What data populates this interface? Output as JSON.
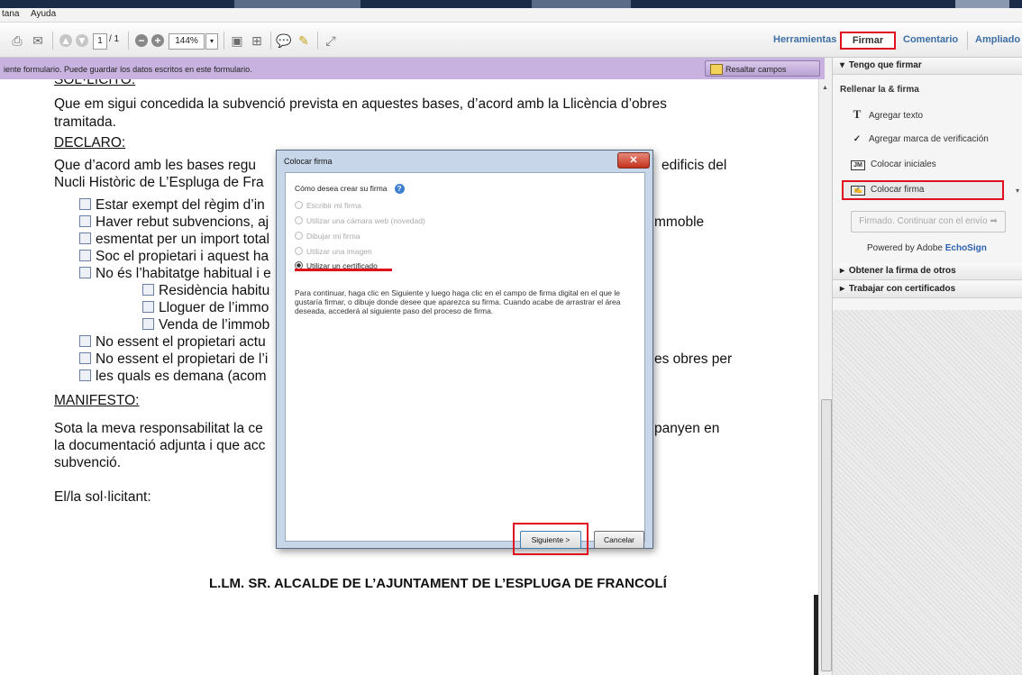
{
  "menubar": {
    "items": [
      "tana",
      "Ayuda"
    ]
  },
  "toolbar": {
    "page_current": "1",
    "page_total": "/ 1",
    "zoom": "144%",
    "tabs": {
      "herramientas": "Herramientas",
      "firmar": "Firmar",
      "comentario": "Comentario",
      "ampliado": "Ampliado"
    }
  },
  "formbar": {
    "message": "iente formulario. Puede guardar los datos escritos en este formulario.",
    "highlight_button": "Resaltar campos existentes"
  },
  "document": {
    "top_cut": "SOL·LICITO:",
    "p1_l1": "Que em sigui concedida la subvenció prevista en aquestes bases, d’acord amb la Llicència d’obres",
    "p1_l2": "tramitada.",
    "declaro": "DECLARO:",
    "p2_l1a": "Que d’acord amb les bases regu",
    "p2_l1b": "edificis del",
    "p2_l2": "Nucli Històric de L’Espluga de Fra",
    "cb1": "Estar exempt del règim d’in",
    "cb2a": "Haver rebut subvencions, aj",
    "cb2b": "mmoble",
    "cb3": "esmentat per un import total",
    "cb4": "Soc el propietari i aquest ha",
    "cb5": "No és l’habitatge habitual i e",
    "cb6": "Residència habitu",
    "cb7": "Lloguer de l’immo",
    "cb8": "Venda de l’immob",
    "cb9": "No essent el propietari actu",
    "cb10a": "No essent el propietari de l’i",
    "cb10b": "es obres per",
    "cb11": "les quals es demana (acom",
    "manifesto": "MANIFESTO:",
    "p3_l1a": "Sota la meva responsabilitat la ce",
    "p3_l1b": "panyen en",
    "p3_l2": "la documentació adjunta i que acc",
    "p3_l3": "subvenció.",
    "sol": "El/la sol·licitant:",
    "footer": "L.LM. SR. ALCALDE DE L’AJUNTAMENT DE L’ESPLUGA DE FRANCOLÍ"
  },
  "right_panel": {
    "section1": "Tengo que firmar",
    "subheading": "Rellenar la & firma",
    "items": [
      {
        "icon": "text-icon",
        "label": "Agregar texto"
      },
      {
        "icon": "checkmark-icon",
        "label": "Agregar marca de verificación"
      },
      {
        "icon": "initials-icon",
        "label": "Colocar iniciales"
      },
      {
        "icon": "signature-icon",
        "label": "Colocar firma"
      }
    ],
    "firmado_button": "Firmado. Continuar con el envío",
    "powered_by": "Powered by Adobe",
    "echosign": "EchoSign",
    "section2": "Obtener la firma de otros",
    "section3": "Trabajar con certificados"
  },
  "dialog": {
    "title": "Colocar firma",
    "question": "Cómo desea crear su firma",
    "options": [
      {
        "label": "Escribir mi firma",
        "selected": false
      },
      {
        "label": "Utilizar una cámara web (novedad)",
        "selected": false
      },
      {
        "label": "Dibujar mi firma",
        "selected": false
      },
      {
        "label": "Utilizar una imagen",
        "selected": false
      },
      {
        "label": "Utilizar un certificado",
        "selected": true
      }
    ],
    "paragraph": "Para continuar, haga clic en Siguiente y luego haga clic en el campo de firma digital en el que le gustaría firmar, o dibuje donde desee que aparezca su firma. Cuando acabe de arrastrar el área deseada, accederá al siguiente paso del proceso de firma.",
    "next_button": "Siguiente >",
    "cancel_button": "Cancelar"
  },
  "colors": {
    "highlight_red": "#e0101c",
    "form_bar": "#c8b3e0",
    "link_blue": "#3d6fa5"
  }
}
